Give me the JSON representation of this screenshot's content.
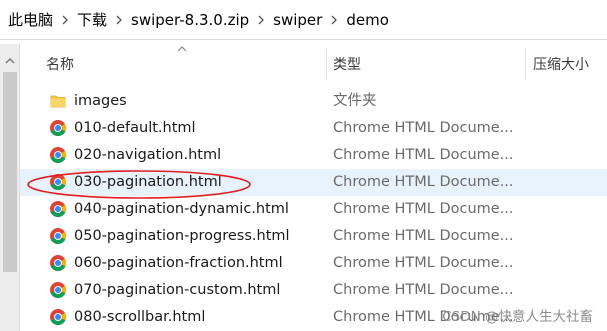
{
  "breadcrumb": {
    "items": [
      "此电脑",
      "下载",
      "swiper-8.3.0.zip",
      "swiper",
      "demo"
    ]
  },
  "columns": {
    "name": "名称",
    "type": "类型",
    "size": "压缩大小"
  },
  "files": [
    {
      "name": "images",
      "type": "文件夹",
      "icon": "folder-icon"
    },
    {
      "name": "010-default.html",
      "type": "Chrome HTML Docume...",
      "icon": "chrome-icon"
    },
    {
      "name": "020-navigation.html",
      "type": "Chrome HTML Docume...",
      "icon": "chrome-icon"
    },
    {
      "name": "030-pagination.html",
      "type": "Chrome HTML Docume...",
      "icon": "chrome-icon",
      "selected": true
    },
    {
      "name": "040-pagination-dynamic.html",
      "type": "Chrome HTML Docume...",
      "icon": "chrome-icon"
    },
    {
      "name": "050-pagination-progress.html",
      "type": "Chrome HTML Docume...",
      "icon": "chrome-icon"
    },
    {
      "name": "060-pagination-fraction.html",
      "type": "Chrome HTML Docume...",
      "icon": "chrome-icon"
    },
    {
      "name": "070-pagination-custom.html",
      "type": "Chrome HTML Docume...",
      "icon": "chrome-icon"
    },
    {
      "name": "080-scrollbar.html",
      "type": "Chrome HTML Docume...",
      "icon": "chrome-icon"
    }
  ],
  "watermark": "CSDN @快意人生大社畜",
  "colors": {
    "annotation": "#e02020",
    "selected_row": "#e8f2fc",
    "folder": "#f5c542"
  }
}
